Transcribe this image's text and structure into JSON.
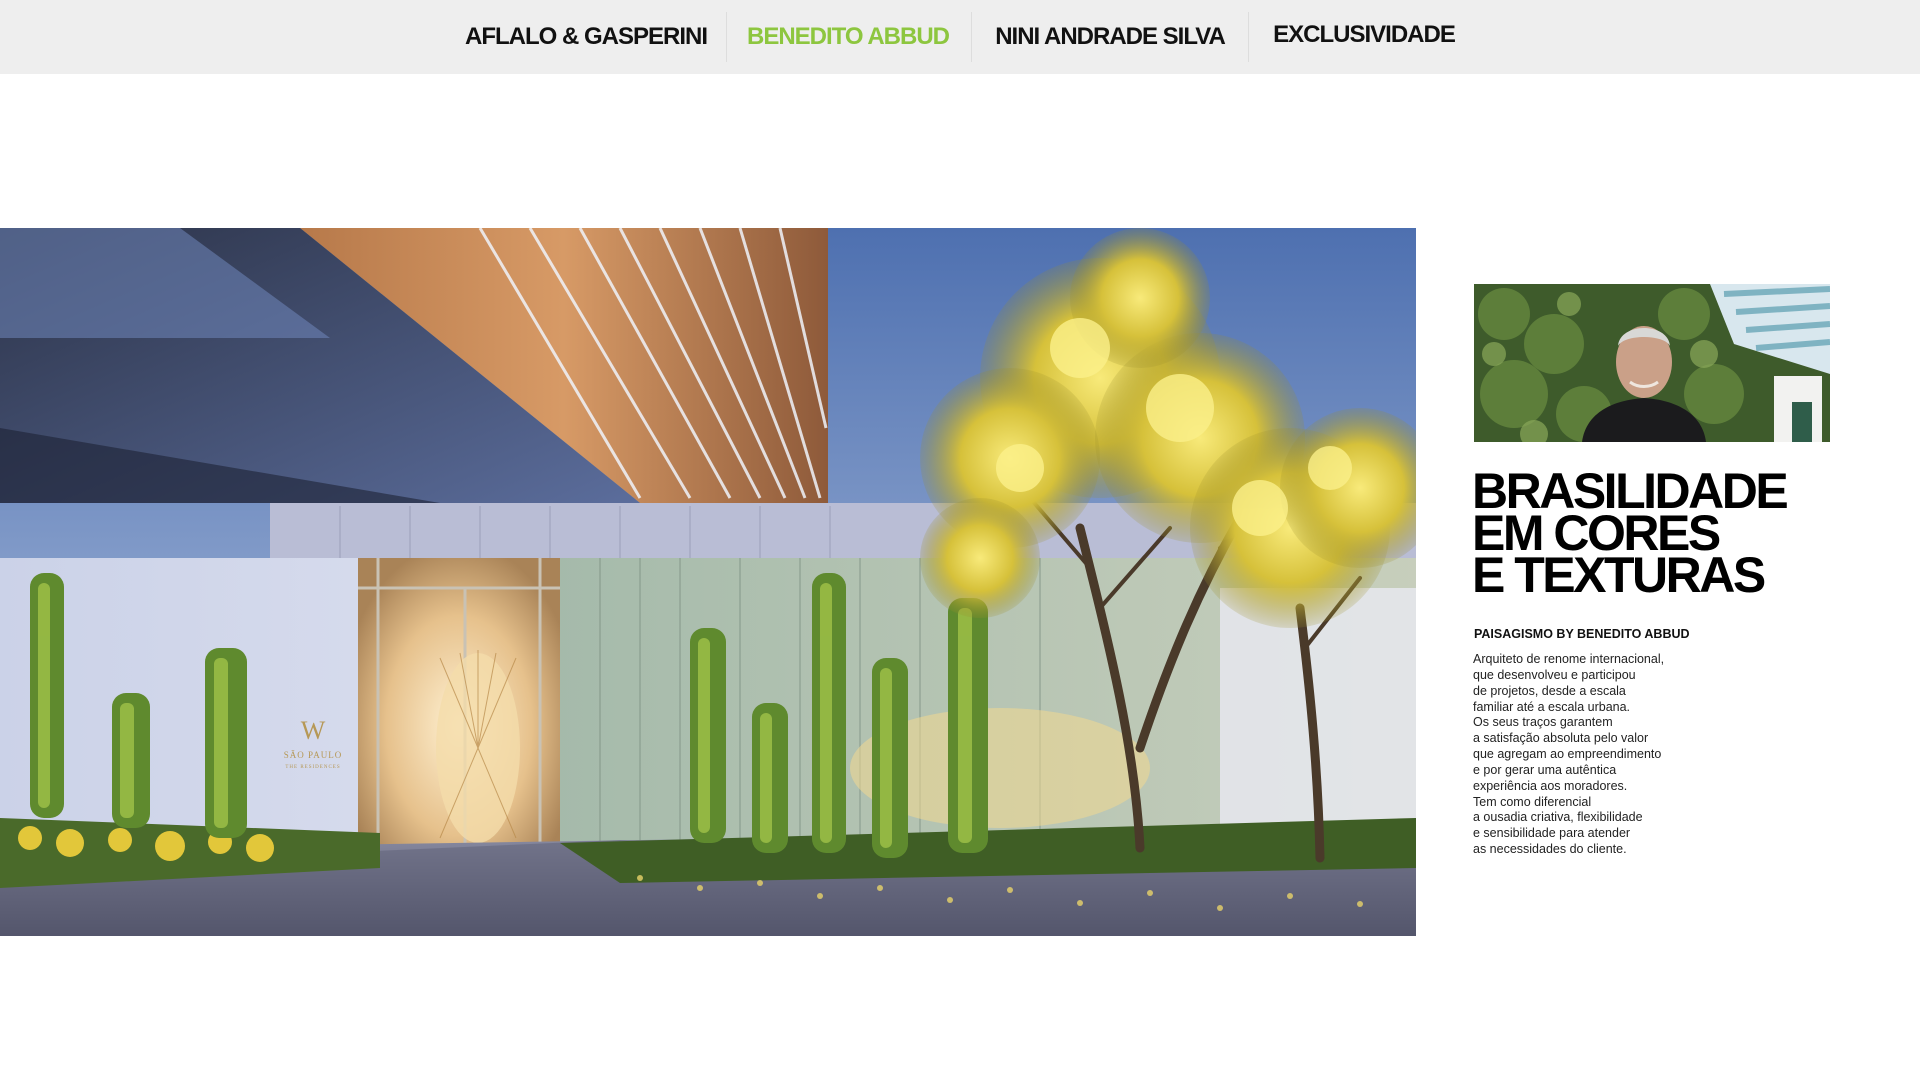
{
  "nav": {
    "items": [
      {
        "label": "AFLALO & GASPERINI",
        "active": false
      },
      {
        "label": "BENEDITO ABBUD",
        "active": true
      },
      {
        "label": "NINI ANDRADE SILVA",
        "active": false
      },
      {
        "label": "EXCLUSIVIDADE",
        "active": false
      }
    ]
  },
  "hero": {
    "sign_logo": "W",
    "sign_city": "SÃO PAULO",
    "sign_sub": "THE RESIDENCES"
  },
  "profile": {
    "headline": [
      "BRASILIDADE",
      "EM CORES",
      "E TEXTURAS"
    ],
    "credit": "PAISAGISMO BY BENEDITO ABBUD",
    "bio": [
      "Arquiteto de renome internacional,",
      "que desenvolveu e participou",
      "de projetos, desde a escala",
      "familiar até a escala urbana.",
      "Os seus traços garantem",
      "a satisfação absoluta pelo valor",
      "que agregam ao empreendimento",
      "e por gerar uma autêntica",
      "experiência aos moradores.",
      "Tem como diferencial",
      "a ousadia criativa, flexibilidade",
      "e sensibilidade para atender",
      "as necessidades do cliente."
    ]
  },
  "colors": {
    "nav_bg": "#eeeeee",
    "nav_active": "#8dc63f",
    "nav_text": "#111111",
    "headline": "#000000"
  }
}
